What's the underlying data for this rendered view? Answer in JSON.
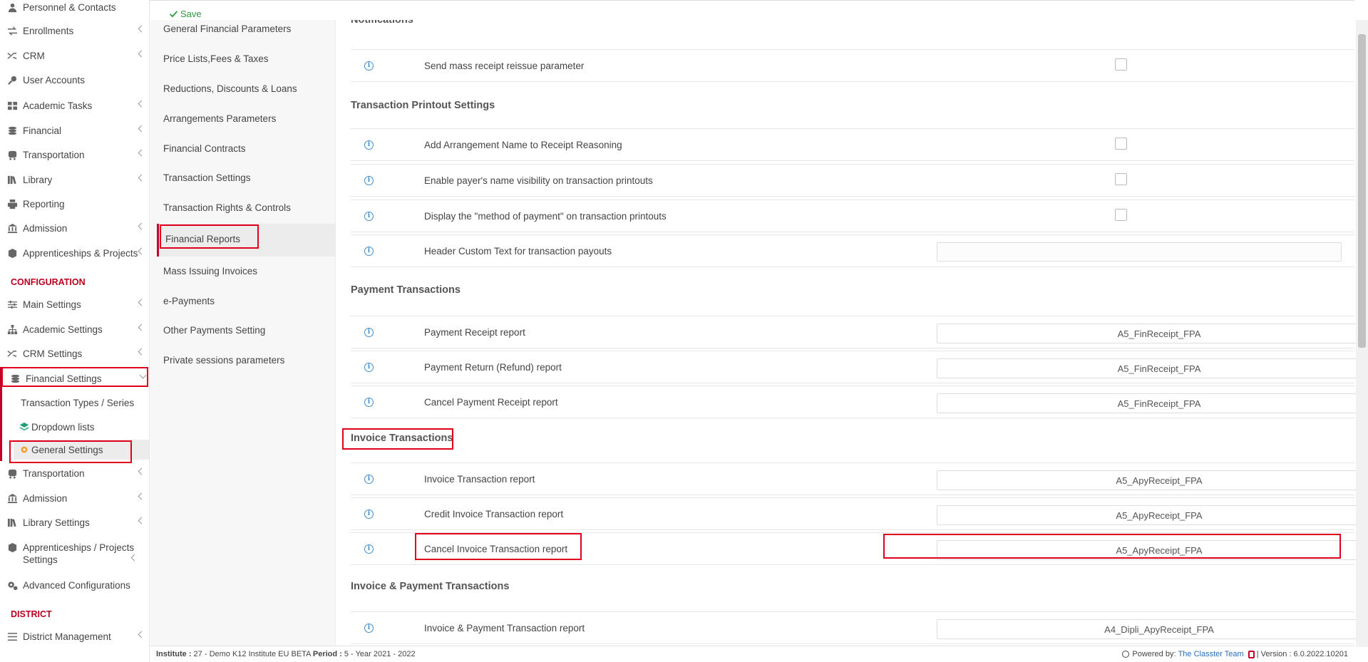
{
  "nav": {
    "items": [
      {
        "label": "Personnel & Contacts",
        "icon": "person-icon",
        "chev": false
      },
      {
        "label": "Enrollments",
        "icon": "swap-arrows-icon",
        "chev": true
      },
      {
        "label": "CRM",
        "icon": "shuffle-icon",
        "chev": true
      },
      {
        "label": "User Accounts",
        "icon": "key-icon",
        "chev": false
      },
      {
        "label": "Academic Tasks",
        "icon": "grid-icon",
        "chev": true
      },
      {
        "label": "Financial",
        "icon": "coins-icon",
        "chev": true
      },
      {
        "label": "Transportation",
        "icon": "bus-icon",
        "chev": true
      },
      {
        "label": "Library",
        "icon": "books-icon",
        "chev": true
      },
      {
        "label": "Reporting",
        "icon": "printer-icon",
        "chev": false
      },
      {
        "label": "Admission",
        "icon": "institution-icon",
        "chev": true
      },
      {
        "label": "Apprenticeships & Projects",
        "icon": "cube-icon",
        "chev": true
      }
    ],
    "config_title": "CONFIGURATION",
    "config_items": [
      {
        "label": "Main Settings",
        "icon": "sliders-icon",
        "chev": true
      },
      {
        "label": "Academic Settings",
        "icon": "sitemap-icon",
        "chev": true
      },
      {
        "label": "CRM Settings",
        "icon": "shuffle-icon",
        "chev": true
      },
      {
        "label": "Financial Settings",
        "icon": "coins-icon",
        "chev": true,
        "open": true
      }
    ],
    "sub_items": [
      {
        "label": "Transaction Types / Series",
        "icon": ""
      },
      {
        "label": "Dropdown lists",
        "icon": "layers-icon"
      },
      {
        "label": "General Settings",
        "icon": "cog-icon"
      }
    ],
    "config_items2": [
      {
        "label": "Transportation",
        "icon": "bus-icon",
        "chev": true
      },
      {
        "label": "Admission",
        "icon": "institution-icon",
        "chev": true
      },
      {
        "label": "Library Settings",
        "icon": "books-icon",
        "chev": true
      },
      {
        "label": "Apprenticeships / Projects Settings",
        "icon": "cube-icon",
        "chev": true
      },
      {
        "label": "Advanced Configurations",
        "icon": "cogs-icon",
        "chev": false
      }
    ],
    "district_title": "DISTRICT",
    "district_items": [
      {
        "label": "District Management",
        "icon": "list-icon",
        "chev": true
      }
    ]
  },
  "toolbar": {
    "save_label": "Save"
  },
  "settings_menu": [
    "General Financial Parameters",
    "Price Lists,Fees & Taxes",
    "Reductions, Discounts & Loans",
    "Arrangements Parameters",
    "Financial Contracts",
    "Transaction Settings",
    "Transaction Rights & Controls",
    "Financial Reports",
    "Mass Issuing Invoices",
    "e-Payments",
    "Other Payments Setting",
    "Private sessions parameters"
  ],
  "main": {
    "notifications_title": "Notifications",
    "sections": [
      {
        "title": "",
        "rows": [
          {
            "label": "Send mass receipt reissue parameter",
            "type": "checkbox"
          }
        ]
      },
      {
        "title": "Transaction Printout Settings",
        "rows": [
          {
            "label": "Add Arrangement Name to Receipt Reasoning",
            "type": "checkbox"
          },
          {
            "label": "Enable payer's name visibility on transaction printouts",
            "type": "checkbox"
          },
          {
            "label": "Display the \"method of payment\" on transaction printouts",
            "type": "checkbox"
          },
          {
            "label": "Header Custom Text for transaction payouts",
            "type": "text",
            "value": ""
          }
        ]
      },
      {
        "title": "Payment Transactions",
        "rows": [
          {
            "label": "Payment Receipt report",
            "type": "select",
            "value": "A5_FinReceipt_FPA"
          },
          {
            "label": "Payment Return (Refund) report",
            "type": "select",
            "value": "A5_FinReceipt_FPA"
          },
          {
            "label": "Cancel Payment Receipt report",
            "type": "select",
            "value": "A5_FinReceipt_FPA"
          }
        ]
      },
      {
        "title": "Invoice Transactions",
        "rows": [
          {
            "label": "Invoice Transaction report",
            "type": "select",
            "value": "A5_ApyReceipt_FPA"
          },
          {
            "label": "Credit Invoice Transaction report",
            "type": "select",
            "value": "A5_ApyReceipt_FPA"
          },
          {
            "label": "Cancel Invoice Transaction report",
            "type": "select",
            "value": "A5_ApyReceipt_FPA"
          }
        ]
      },
      {
        "title": "Invoice & Payment Transactions",
        "rows": [
          {
            "label": "Invoice & Payment Transaction report",
            "type": "select",
            "value": "A4_Dipli_ApyReceipt_FPA"
          }
        ]
      }
    ]
  },
  "footer": {
    "institute_label": "Institute :",
    "institute_value": " 27 - Demo K12 Institute EU BETA ",
    "period_label": "Period :",
    "period_value": " 5 - Year 2021 - 2022",
    "powered_label": "Powered by:",
    "powered_link": "The Classter Team",
    "version": " | Version : 6.0.2022.10201"
  },
  "colors": {
    "accent": "#b8001f",
    "highlight": "#e0001b",
    "save": "#2f9c43",
    "info": "#3f8fd0",
    "link": "#2a6ebb"
  }
}
